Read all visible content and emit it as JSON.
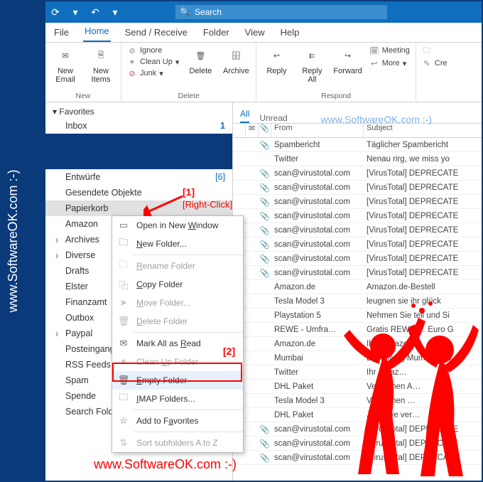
{
  "watermark": "www.SoftwareOK.com :-)",
  "titlebar": {
    "search_placeholder": "Search"
  },
  "menubar": {
    "file": "File",
    "home": "Home",
    "sendreceive": "Send / Receive",
    "folder": "Folder",
    "view": "View",
    "help": "Help"
  },
  "ribbon": {
    "new": {
      "label": "New",
      "email": "New Email",
      "items": "New Items"
    },
    "delete": {
      "label": "Delete",
      "ignore": "Ignore",
      "cleanup": "Clean Up",
      "junk": "Junk",
      "delete": "Delete",
      "archive": "Archive"
    },
    "respond": {
      "label": "Respond",
      "reply": "Reply",
      "replyall": "Reply All",
      "forward": "Forward",
      "meeting": "Meeting",
      "more": "More"
    },
    "quick": {
      "create": "Cre"
    }
  },
  "nav": {
    "favorites": "Favorites",
    "inbox": "Inbox",
    "inbox_count": "1",
    "entw": "Entwürfe",
    "entw_count": "[6]",
    "gesendete": "Gesendete Objekte",
    "papierkorb": "Papierkorb",
    "amazon": "Amazon",
    "archives": "Archives",
    "diverse": "Diverse",
    "drafts": "Drafts",
    "elster": "Elster",
    "finanzamt": "Finanzamt",
    "outbox": "Outbox",
    "paypal": "Paypal",
    "posteingang": "Posteingang",
    "rss": "RSS Feeds",
    "spam": "Spam",
    "spende": "Spende",
    "search": "Search Folders",
    "sort": "Sort subfolders A to Z"
  },
  "mailtabs": {
    "all": "All",
    "unread": "Unread"
  },
  "mailhead": {
    "from": "From",
    "subject": "Subject",
    "attach": "📎"
  },
  "rows": [
    {
      "a": "1",
      "f": "Spambericht",
      "s": "Täglicher Spambericht"
    },
    {
      "a": "",
      "f": "Twitter",
      "s": "Nenau rirg, we miss yo"
    },
    {
      "a": "1",
      "f": "scan@virustotal.com",
      "s": "[VirusTotal] DEPRECATE"
    },
    {
      "a": "1",
      "f": "scan@virustotal.com",
      "s": "[VirusTotal] DEPRECATE"
    },
    {
      "a": "1",
      "f": "scan@virustotal.com",
      "s": "[VirusTotal] DEPRECATE"
    },
    {
      "a": "1",
      "f": "scan@virustotal.com",
      "s": "[VirusTotal] DEPRECATE"
    },
    {
      "a": "1",
      "f": "scan@virustotal.com",
      "s": "[VirusTotal] DEPRECATE"
    },
    {
      "a": "1",
      "f": "scan@virustotal.com",
      "s": "[VirusTotal] DEPRECATE"
    },
    {
      "a": "1",
      "f": "scan@virustotal.com",
      "s": "[VirusTotal] DEPRECATE"
    },
    {
      "a": "1",
      "f": "scan@virustotal.com",
      "s": "[VirusTotal] DEPRECATE"
    },
    {
      "a": "",
      "f": "Amazon.de",
      "s": "Amazon.de-Bestell"
    },
    {
      "a": "",
      "f": "Tesla Model 3",
      "s": "leugnen sie ihr glück"
    },
    {
      "a": "",
      "f": "Playstation 5",
      "s": "Nehmen Sie teil und Si"
    },
    {
      "a": "",
      "f": "REWE - Umfra…",
      "s": "Gratis REWE … Euro G"
    },
    {
      "a": "",
      "f": "Amazon.de",
      "s": "Ihre Amazon…"
    },
    {
      "a": "",
      "f": "Mumbai",
      "s": "Bestellung Mumbai: Lie"
    },
    {
      "a": "",
      "f": "Twitter",
      "s": "Ihr Amaz…"
    },
    {
      "a": "",
      "f": "DHL Paket",
      "s": "Versuchen A…"
    },
    {
      "a": "",
      "f": "Tesla Model 3",
      "s": "Versuchen …"
    },
    {
      "a": "",
      "f": "DHL Paket",
      "s": "Jetzt live ver…"
    },
    {
      "a": "1",
      "f": "scan@virustotal.com",
      "s": "[VirusTotal] DEPRECATE"
    },
    {
      "a": "1",
      "f": "scan@virustotal.com",
      "s": "[VirusTotal] DEPRECATE"
    },
    {
      "a": "1",
      "f": "scan@virustotal.com",
      "s": "[VirusTotal] DEPRECATE"
    }
  ],
  "ctx": {
    "open": "Open in New Window",
    "newfolder": "New Folder...",
    "rename": "Rename Folder",
    "copy": "Copy Folder",
    "move": "Move Folder...",
    "delete": "Delete Folder",
    "markread": "Mark All as Read",
    "cleanup": "Clean Up Folder",
    "empty": "Empty Folder",
    "imap": "IMAP Folders...",
    "addfav": "Add to Favorites"
  },
  "anno": {
    "one": "[1]",
    "rc": "[Right-Click]",
    "two": "[2]"
  }
}
